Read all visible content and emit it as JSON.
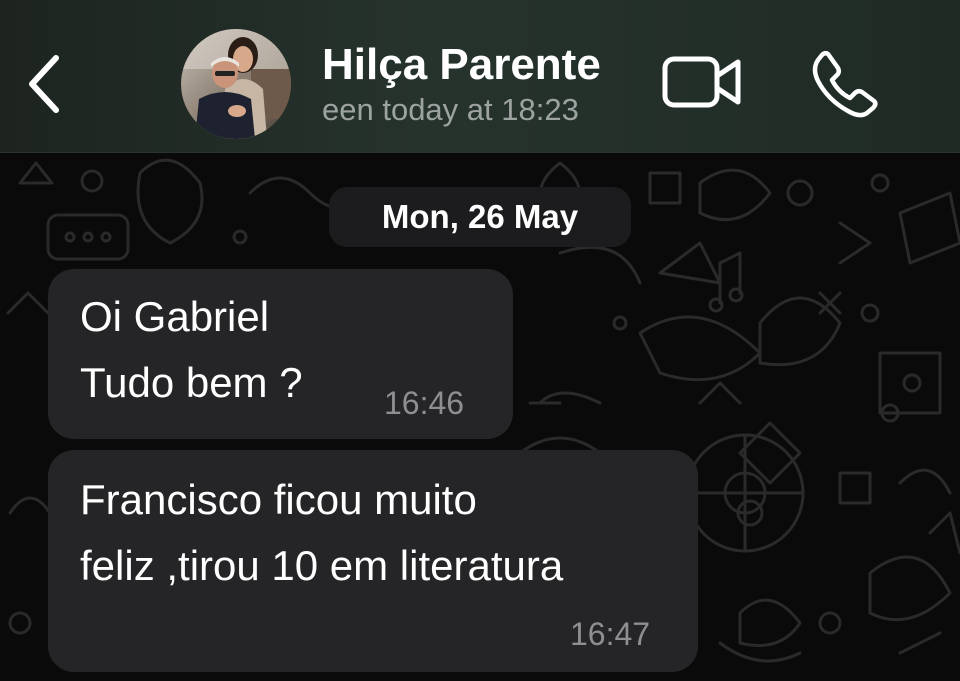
{
  "header": {
    "contact_name": "Hilça Parente",
    "last_seen": "een today at 18:23",
    "back_icon": "chevron-left-icon",
    "video_icon": "video-camera-icon",
    "call_icon": "phone-icon"
  },
  "chat": {
    "date_label": "Mon, 26 May",
    "messages": [
      {
        "lines": [
          "Oi Gabriel",
          "Tudo bem ?"
        ],
        "time": "16:46"
      },
      {
        "lines": [
          "Francisco ficou muito",
          "feliz ,tirou 10 em literatura"
        ],
        "time": "16:47"
      }
    ]
  },
  "colors": {
    "header_bg": "#26332c",
    "chat_bg": "#0a0a0a",
    "bubble_bg": "#252527",
    "text": "#ffffff",
    "secondary_text": "#9da3a0",
    "time_text": "#8e8e93"
  }
}
